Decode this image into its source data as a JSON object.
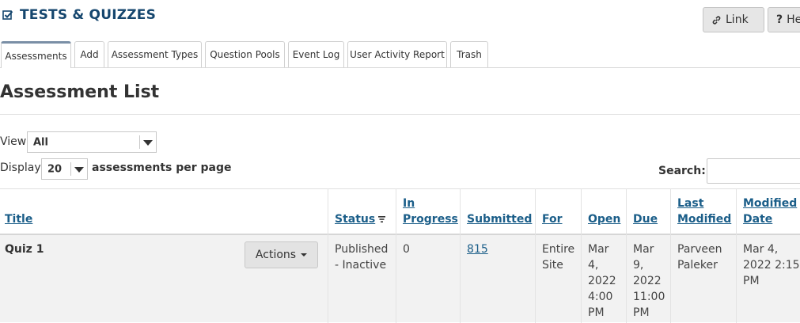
{
  "header": {
    "title": "TESTS & QUIZZES",
    "link_button": "Link",
    "help_button": "He"
  },
  "tabs": [
    {
      "label": "Assessments",
      "active": true
    },
    {
      "label": "Add"
    },
    {
      "label": "Assessment Types"
    },
    {
      "label": "Question Pools"
    },
    {
      "label": "Event Log"
    },
    {
      "label": "User Activity Report"
    },
    {
      "label": "Trash"
    }
  ],
  "page": {
    "title": "Assessment List",
    "view_label": "View",
    "view_value": "All",
    "display_label": "Display",
    "display_value": "20",
    "per_page_label": "assessments per page",
    "search_label": "Search:"
  },
  "table": {
    "columns": {
      "title": "Title",
      "status": "Status",
      "in_progress_1": "In",
      "in_progress_2": "Progress",
      "submitted": "Submitted",
      "for": "For",
      "open": "Open",
      "due": "Due",
      "last_modified_1": "Last",
      "last_modified_2": "Modified",
      "modified_date_1": "Modified",
      "modified_date_2": "Date"
    },
    "rows": [
      {
        "title": "Quiz 1",
        "actions": "Actions",
        "status_1": "Published",
        "status_2": "- Inactive",
        "in_progress": "0",
        "submitted": "815",
        "for_1": "Entire",
        "for_2": "Site",
        "open_1": "Mar",
        "open_2": "4,",
        "open_3": "2022",
        "open_4": "4:00",
        "open_5": "PM",
        "due_1": "Mar",
        "due_2": "9,",
        "due_3": "2022",
        "due_4": "11:00",
        "due_5": "PM",
        "modified_by_1": "Parveen",
        "modified_by_2": "Paleker",
        "modified_date_1": "Mar 4,",
        "modified_date_2": "2022 2:15",
        "modified_date_3": "PM"
      }
    ]
  },
  "colors": {
    "title": "#15466e",
    "link": "#1b5e89",
    "row_bg": "#f2f2f2"
  }
}
